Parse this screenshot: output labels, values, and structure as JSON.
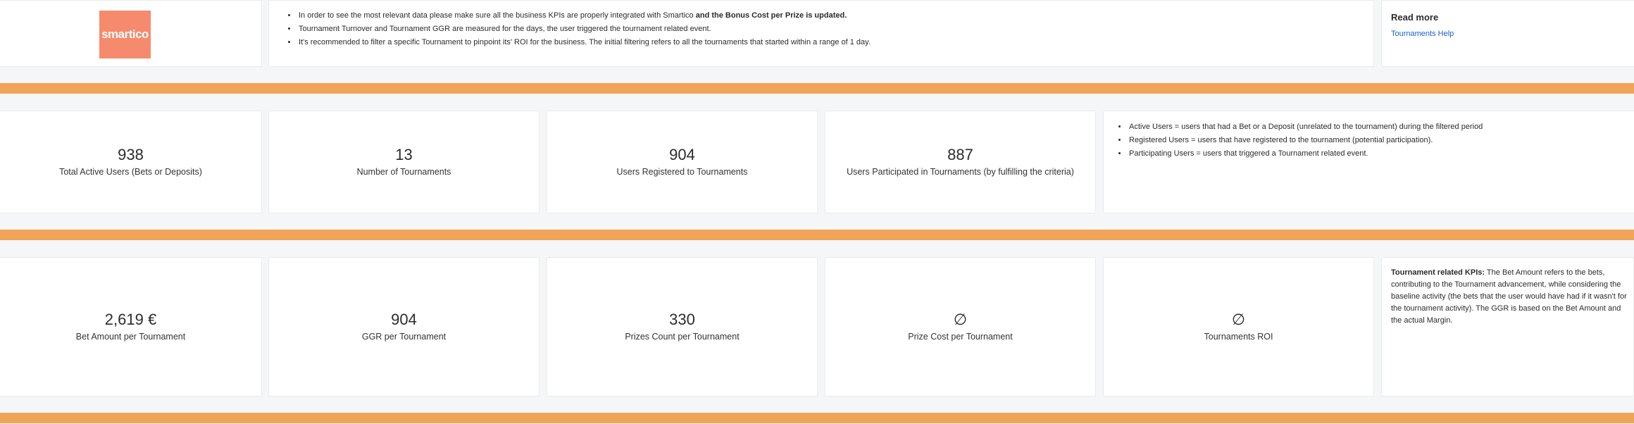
{
  "header": {
    "logo_text": "smartico",
    "notes": [
      {
        "text": "In order to see the most relevant data please make sure all the business KPIs are properly integrated with Smartico ",
        "bold": "and the Bonus Cost per Prize is updated."
      },
      {
        "text": "Tournament Turnover and Tournament GGR are measured for the days, the user triggered the tournament related event.",
        "bold": ""
      },
      {
        "text": "It's recommended to filter a specific Tournament to pinpoint its' ROI for the business. The initial filtering refers to all the tournaments that started within a range of 1 day.",
        "bold": ""
      }
    ],
    "read_more": "Read more",
    "help_link": "Tournaments Help"
  },
  "row1": {
    "kpis": [
      {
        "value": "938",
        "label": "Total Active Users (Bets or Deposits)"
      },
      {
        "value": "13",
        "label": "Number of Tournaments"
      },
      {
        "value": "904",
        "label": "Users Registered to Tournaments"
      },
      {
        "value": "887",
        "label": "Users Participated in Tournaments (by fulfilling the criteria)"
      }
    ],
    "definitions": [
      "Active Users = users that had a Bet or a Deposit (unrelated to the tournament) during the filtered period",
      "Registered Users = users that have registered to the tournament (potential participation).",
      "Participating Users = users that triggered a Tournament related event."
    ]
  },
  "row2": {
    "kpis": [
      {
        "value": "2,619 €",
        "label": "Bet Amount per Tournament"
      },
      {
        "value": "904",
        "label": "GGR per Tournament"
      },
      {
        "value": "330",
        "label": "Prizes Count per Tournament"
      },
      {
        "value": "∅",
        "label": "Prize Cost per Tournament"
      },
      {
        "value": "∅",
        "label": "Tournaments ROI"
      }
    ],
    "desc_title": "Tournament related KPIs:",
    "desc_text": " The Bet Amount refers to the bets, contributing to the Tournament advancement, while considering the baseline activity (the bets that the user would have had if it wasn't for the tournament activity). The GGR is based on the Bet Amount and the actual Margin."
  },
  "colors": {
    "accent_band": "#f0a458",
    "logo_bg": "#f58a6d",
    "link": "#1a62c9"
  }
}
